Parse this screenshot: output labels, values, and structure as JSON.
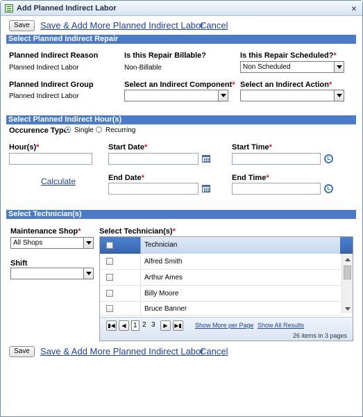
{
  "window": {
    "title": "Add Planned Indirect Labor",
    "close_glyph": "×"
  },
  "toolbar": {
    "save_label": "Save",
    "save_add_more_label": "Save & Add More Planned Indirect Labor",
    "cancel_label": "Cancel"
  },
  "sections": {
    "repair": "Select Planned Indirect Repair",
    "hours": "Select Planned Indirect Hour(s)",
    "technicians": "Select Technician(s)"
  },
  "repair": {
    "reason_label": "Planned Indirect Reason",
    "reason_value": "Planned Indirect Labor",
    "billable_label": "Is this Repair Billable?",
    "billable_value": "Non-Billable",
    "scheduled_label": "Is this Repair Scheduled?",
    "scheduled_value": "Non Scheduled",
    "group_label": "Planned Indirect Group",
    "group_value": "Planned Indirect Labor",
    "component_label": "Select an Indirect Component",
    "component_value": "",
    "action_label": "Select an Indirect Action",
    "action_value": ""
  },
  "hours": {
    "occurrence_label": "Occurence Type:",
    "single_label": "Single",
    "recurring_label": "Recurring",
    "selected": "Single",
    "hours_label": "Hour(s)",
    "start_date_label": "Start Date",
    "start_time_label": "Start Time",
    "end_date_label": "End Date",
    "end_time_label": "End Time",
    "calculate_label": "Calculate",
    "hours_value": "",
    "start_date_value": "",
    "start_time_value": "",
    "end_date_value": "",
    "end_time_value": ""
  },
  "technicians": {
    "shop_label": "Maintenance Shop",
    "shop_value": "All Shops",
    "shift_label": "Shift",
    "shift_value": "",
    "select_label": "Select Technician(s)",
    "grid": {
      "header": "Technician",
      "rows": [
        "Alfred Smith",
        "Arthur Ames",
        "Billy Moore",
        "Bruce Banner"
      ],
      "pages": [
        "1",
        "2",
        "3"
      ],
      "current_page": "1",
      "show_more": "Show More per Page",
      "show_all": "Show All Results",
      "info": "26 items in 3 pages"
    }
  },
  "required_marker": "*",
  "icons": [
    "window-icon",
    "close-icon",
    "calendar-icon",
    "clock-icon",
    "dropdown-arrow-icon"
  ]
}
